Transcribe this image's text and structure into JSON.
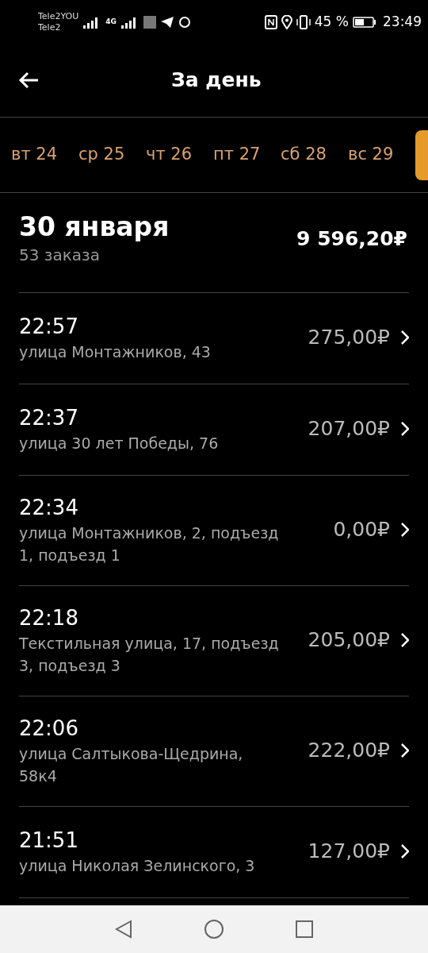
{
  "status_bar": {
    "carrier_1": "Tele2YOU",
    "carrier_2": "Tele2",
    "network": "4G",
    "battery_percent": "45 %",
    "time": "23:49"
  },
  "header": {
    "title": "За день"
  },
  "days": [
    {
      "label": "вт 24",
      "selected": false
    },
    {
      "label": "ср 25",
      "selected": false
    },
    {
      "label": "чт 26",
      "selected": false
    },
    {
      "label": "пт 27",
      "selected": false
    },
    {
      "label": "сб 28",
      "selected": false
    },
    {
      "label": "вс 29",
      "selected": false
    },
    {
      "selected": true
    }
  ],
  "summary": {
    "date": "30 января",
    "orders_count": "53 заказа",
    "total": "9 596,20₽"
  },
  "orders": [
    {
      "time": "22:57",
      "address": "улица Монтажников, 43",
      "price": "275,00₽"
    },
    {
      "time": "22:37",
      "address": "улица 30 лет Победы, 76",
      "price": "207,00₽"
    },
    {
      "time": "22:34",
      "address": "улица Монтажников, 2, подъезд 1, подъезд 1",
      "price": "0,00₽"
    },
    {
      "time": "22:18",
      "address": "Текстильная улица, 17, подъезд 3, подъезд 3",
      "price": "205,00₽"
    },
    {
      "time": "22:06",
      "address": "улица Салтыкова-Щедрина, 58к4",
      "price": "222,00₽"
    },
    {
      "time": "21:51",
      "address": "улица Николая Зелинского, 3",
      "price": "127,00₽"
    }
  ]
}
